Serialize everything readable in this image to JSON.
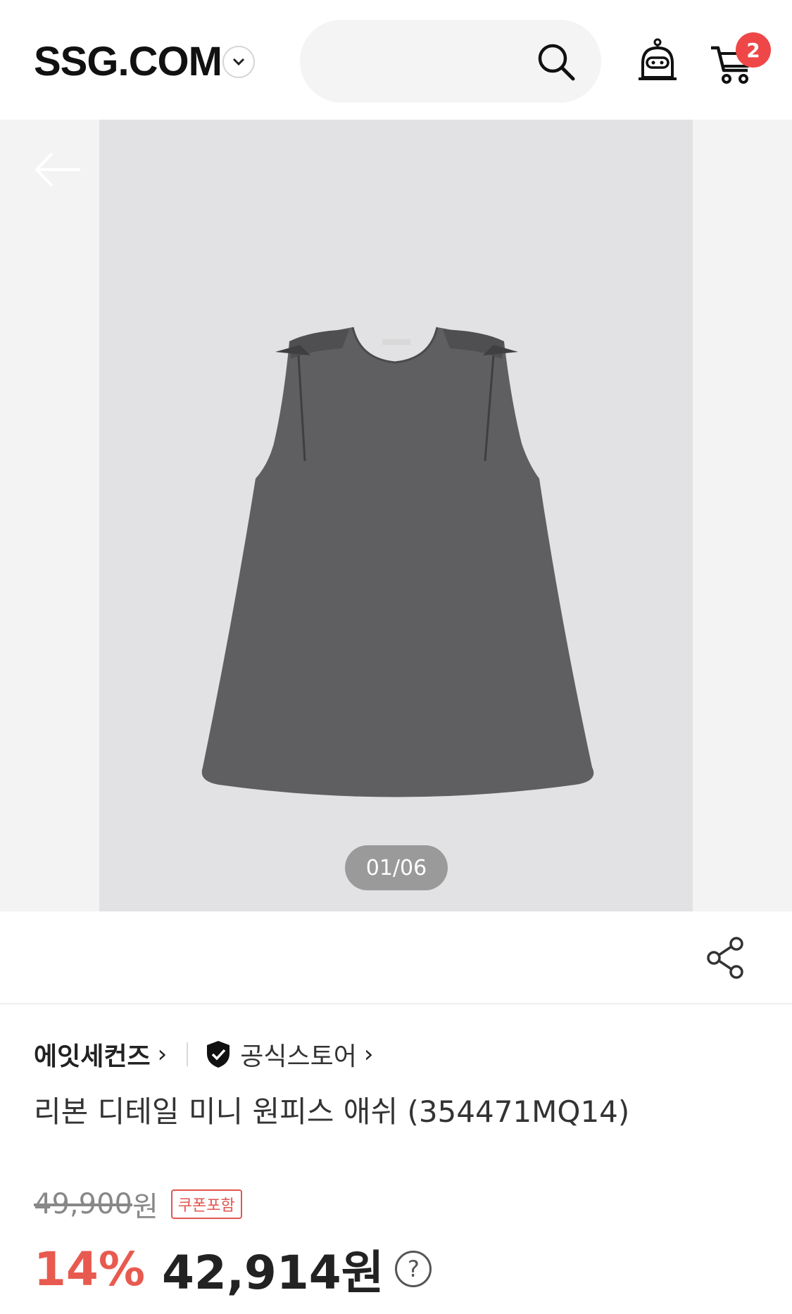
{
  "header": {
    "logo": "SSG.COM",
    "cart_count": "2",
    "icons": [
      "chevron-down-icon",
      "search-icon",
      "bot-icon",
      "cart-icon"
    ]
  },
  "gallery": {
    "counter": "01/06",
    "icons": [
      "back-arrow-icon"
    ]
  },
  "product": {
    "brand": "에잇세컨즈",
    "store_label": "공식스토어",
    "title": "리본 디테일 미니 원피스  애쉬 (354471MQ14)",
    "original_price": "49,900",
    "currency": "원",
    "coupon_tag": "쿠폰포함",
    "discount": "14%",
    "final_price": "42,914원",
    "help_mark": "?"
  },
  "colors": {
    "accent_red": "#e85a4f",
    "badge_red": "#ef4747"
  }
}
